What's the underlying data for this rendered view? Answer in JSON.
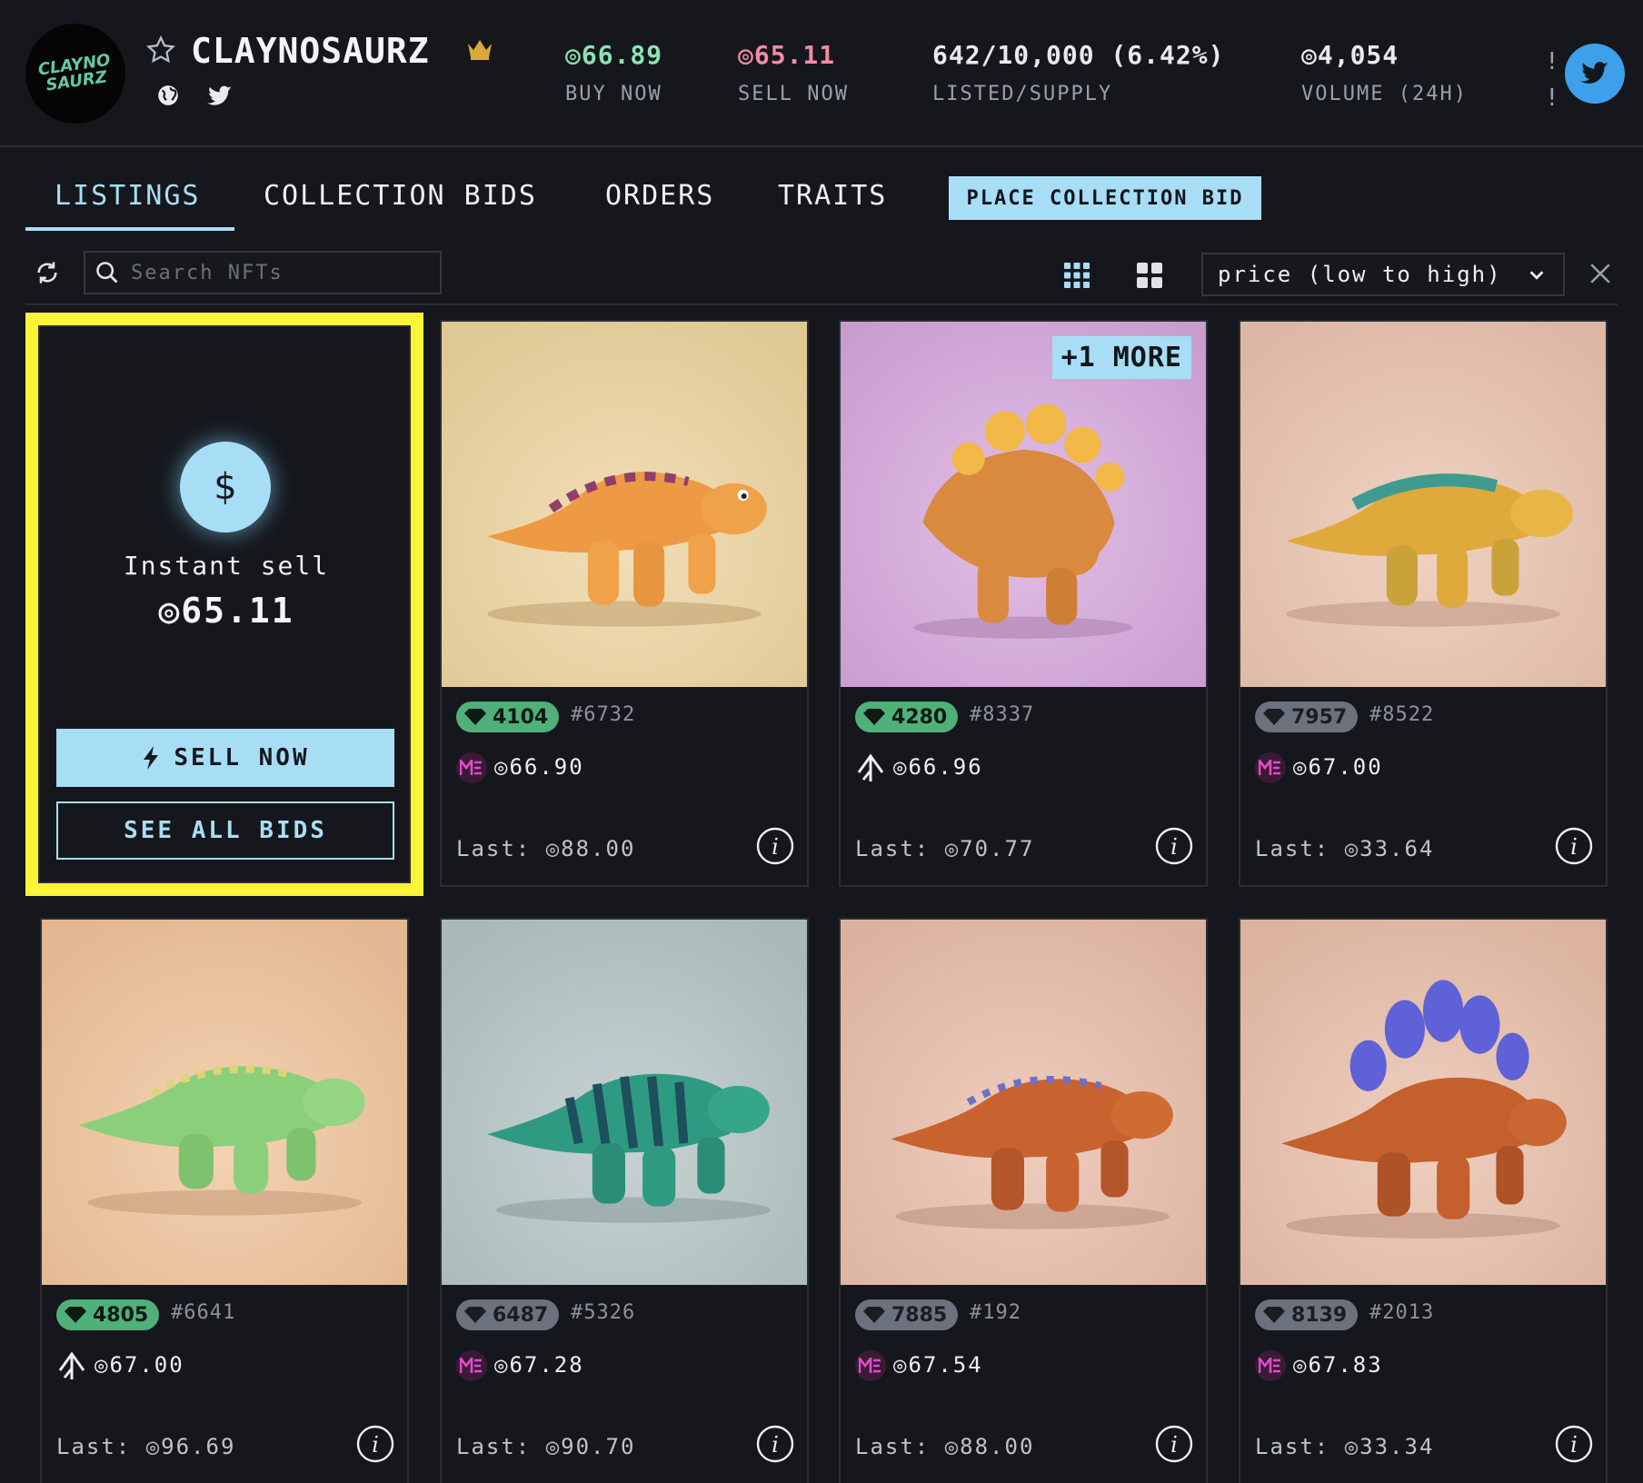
{
  "header": {
    "logo_text": "CLAYNO SAURZ",
    "title": "CLAYNOSAURZ",
    "stats": {
      "buy_now": {
        "value": "◎66.89",
        "label": "BUY NOW"
      },
      "sell_now": {
        "value": "◎65.11",
        "label": "SELL NOW"
      },
      "listed": {
        "value": "642/10,000 (6.42%)",
        "label": "LISTED/SUPPLY"
      },
      "volume": {
        "value": "◎4,054",
        "label": "VOLUME (24H)"
      }
    },
    "truncated_stat_glyph": "!\n!"
  },
  "tabs": {
    "listings": "LISTINGS",
    "collection_bids": "COLLECTION BIDS",
    "orders": "ORDERS",
    "traits": "TRAITS",
    "place_bid": "PLACE COLLECTION BID"
  },
  "toolbar": {
    "search_placeholder": "Search NFTs",
    "sort_selected": "price (low to high)"
  },
  "instant_sell": {
    "icon_symbol": "$",
    "label": "Instant sell",
    "price": "◎65.11",
    "sell_now": "SELL NOW",
    "see_all": "SEE ALL BIDS"
  },
  "cards": [
    {
      "rank": "4104",
      "rank_style": "green",
      "id": "#6732",
      "market": "magic-eden",
      "price": "◎66.90",
      "last": "Last: ◎88.00",
      "badge": ""
    },
    {
      "rank": "4280",
      "rank_style": "green",
      "id": "#8337",
      "market": "tensor",
      "price": "◎66.96",
      "last": "Last: ◎70.77",
      "badge": "+1 MORE"
    },
    {
      "rank": "7957",
      "rank_style": "gray",
      "id": "#8522",
      "market": "magic-eden",
      "price": "◎67.00",
      "last": "Last: ◎33.64",
      "badge": ""
    },
    {
      "rank": "4805",
      "rank_style": "green",
      "id": "#6641",
      "market": "tensor",
      "price": "◎67.00",
      "last": "Last: ◎96.69",
      "badge": ""
    },
    {
      "rank": "6487",
      "rank_style": "gray",
      "id": "#5326",
      "market": "magic-eden",
      "price": "◎67.28",
      "last": "Last: ◎90.70",
      "badge": ""
    },
    {
      "rank": "7885",
      "rank_style": "gray",
      "id": "#192",
      "market": "magic-eden",
      "price": "◎67.54",
      "last": "Last: ◎88.00",
      "badge": ""
    },
    {
      "rank": "8139",
      "rank_style": "gray",
      "id": "#2013",
      "market": "magic-eden",
      "price": "◎67.83",
      "last": "Last: ◎33.34",
      "badge": ""
    }
  ],
  "colors": {
    "accent": "#a8def5",
    "highlight": "#fbf437",
    "buy_green": "#8be3b3",
    "sell_pink": "#f38ba6"
  }
}
